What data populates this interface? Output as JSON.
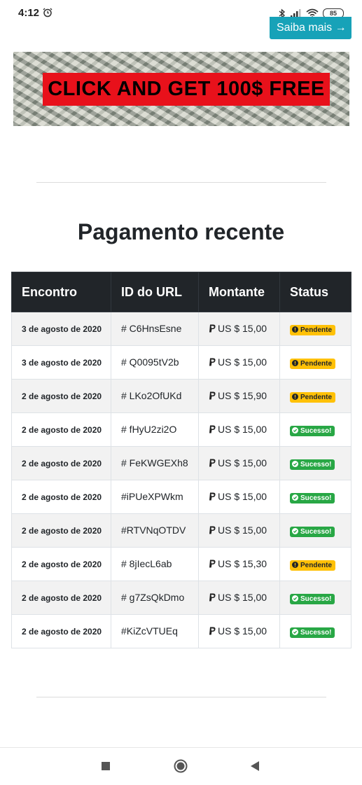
{
  "status_bar": {
    "time": "4:12",
    "battery": "85",
    "icons": [
      "alarm-icon",
      "bluetooth-icon",
      "signal-icon",
      "wifi-icon",
      "battery-icon"
    ]
  },
  "top_button": {
    "label": "Saiba mais →"
  },
  "banner": {
    "text": "CLICK AND GET 100$ FREE",
    "bg_color": "#e8111b"
  },
  "section": {
    "title": "Pagamento recente"
  },
  "table": {
    "headers": [
      "Encontro",
      "ID do URL",
      "Montante",
      "Status"
    ],
    "rows": [
      {
        "date": "3 de agosto de 2020",
        "id": "# C6HnsEsne",
        "amount": "US $ 15,00",
        "status": "Pendente",
        "kind": "pend"
      },
      {
        "date": "3 de agosto de 2020",
        "id": "# Q0095tV2b",
        "amount": "US $ 15,00",
        "status": "Pendente",
        "kind": "pend"
      },
      {
        "date": "2 de agosto de 2020",
        "id": "# LKo2OfUKd",
        "amount": "US $ 15,90",
        "status": "Pendente",
        "kind": "pend"
      },
      {
        "date": "2 de agosto de 2020",
        "id": "# fHyU2zi2O",
        "amount": "US $ 15,00",
        "status": "Sucesso!",
        "kind": "ok"
      },
      {
        "date": "2 de agosto de 2020",
        "id": "# FeKWGEXh8",
        "amount": "US $ 15,00",
        "status": "Sucesso!",
        "kind": "ok"
      },
      {
        "date": "2 de agosto de 2020",
        "id": "#iPUeXPWkm",
        "amount": "US $ 15,00",
        "status": "Sucesso!",
        "kind": "ok"
      },
      {
        "date": "2 de agosto de 2020",
        "id": "#RTVNqOTDV",
        "amount": "US $ 15,00",
        "status": "Sucesso!",
        "kind": "ok"
      },
      {
        "date": "2 de agosto de 2020",
        "id": "# 8jIecL6ab",
        "amount": "US $ 15,30",
        "status": "Pendente",
        "kind": "pend"
      },
      {
        "date": "2 de agosto de 2020",
        "id": "# g7ZsQkDmo",
        "amount": "US $ 15,00",
        "status": "Sucesso!",
        "kind": "ok"
      },
      {
        "date": "2 de agosto de 2020",
        "id": "#KiZcVTUEq",
        "amount": "US $ 15,00",
        "status": "Sucesso!",
        "kind": "ok"
      }
    ],
    "colors": {
      "header_bg": "#212529",
      "pending": "#ffc107",
      "success": "#28a745"
    }
  },
  "nav": {
    "icons": [
      "recents-square-icon",
      "home-circle-icon",
      "back-triangle-icon"
    ]
  }
}
